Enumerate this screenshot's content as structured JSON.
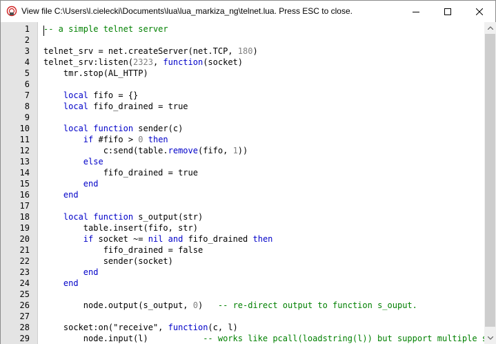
{
  "window": {
    "title": "View file C:\\Users\\l.cielecki\\Documents\\lua\\lua_markiza_ng\\telnet.lua. Press ESC to close.",
    "icons": {
      "app": "telnet-app-icon",
      "minimize": "minimize-icon",
      "maximize": "maximize-icon",
      "close": "close-icon"
    }
  },
  "editor": {
    "language": "lua",
    "lines": [
      {
        "n": "1",
        "segs": [
          [
            "cm",
            "-- a simple telnet server"
          ]
        ]
      },
      {
        "n": "2",
        "segs": []
      },
      {
        "n": "3",
        "segs": [
          [
            "t",
            "telnet_srv = net.createServer(net.TCP, "
          ],
          [
            "nm",
            "180"
          ],
          [
            "t",
            ")"
          ]
        ]
      },
      {
        "n": "4",
        "segs": [
          [
            "t",
            "telnet_srv:listen("
          ],
          [
            "nm",
            "2323"
          ],
          [
            "t",
            ", "
          ],
          [
            "kw",
            "function"
          ],
          [
            "t",
            "(socket)"
          ]
        ]
      },
      {
        "n": "5",
        "segs": [
          [
            "t",
            "    tmr.stop(AL_HTTP)"
          ]
        ]
      },
      {
        "n": "6",
        "segs": []
      },
      {
        "n": "7",
        "segs": [
          [
            "t",
            "    "
          ],
          [
            "kw",
            "local"
          ],
          [
            "t",
            " fifo = {}"
          ]
        ]
      },
      {
        "n": "8",
        "segs": [
          [
            "t",
            "    "
          ],
          [
            "kw",
            "local"
          ],
          [
            "t",
            " fifo_drained = true"
          ]
        ]
      },
      {
        "n": "9",
        "segs": []
      },
      {
        "n": "10",
        "segs": [
          [
            "t",
            "    "
          ],
          [
            "kw",
            "local function"
          ],
          [
            "t",
            " sender(c)"
          ]
        ]
      },
      {
        "n": "11",
        "segs": [
          [
            "t",
            "        "
          ],
          [
            "kw",
            "if"
          ],
          [
            "t",
            " #fifo > "
          ],
          [
            "nm",
            "0"
          ],
          [
            "t",
            " "
          ],
          [
            "kw",
            "then"
          ]
        ]
      },
      {
        "n": "12",
        "segs": [
          [
            "t",
            "            c:send(table."
          ],
          [
            "fn",
            "remove"
          ],
          [
            "t",
            "(fifo, "
          ],
          [
            "nm",
            "1"
          ],
          [
            "t",
            "))"
          ]
        ]
      },
      {
        "n": "13",
        "segs": [
          [
            "t",
            "        "
          ],
          [
            "kw",
            "else"
          ]
        ]
      },
      {
        "n": "14",
        "segs": [
          [
            "t",
            "            fifo_drained = true"
          ]
        ]
      },
      {
        "n": "15",
        "segs": [
          [
            "t",
            "        "
          ],
          [
            "kw",
            "end"
          ]
        ]
      },
      {
        "n": "16",
        "segs": [
          [
            "t",
            "    "
          ],
          [
            "kw",
            "end"
          ]
        ]
      },
      {
        "n": "17",
        "segs": []
      },
      {
        "n": "18",
        "segs": [
          [
            "t",
            "    "
          ],
          [
            "kw",
            "local function"
          ],
          [
            "t",
            " s_output(str)"
          ]
        ]
      },
      {
        "n": "19",
        "segs": [
          [
            "t",
            "        table.insert(fifo, str)"
          ]
        ]
      },
      {
        "n": "20",
        "segs": [
          [
            "t",
            "        "
          ],
          [
            "kw",
            "if"
          ],
          [
            "t",
            " socket ~= "
          ],
          [
            "kw",
            "nil"
          ],
          [
            "t",
            " "
          ],
          [
            "kw",
            "and"
          ],
          [
            "t",
            " fifo_drained "
          ],
          [
            "kw",
            "then"
          ]
        ]
      },
      {
        "n": "21",
        "segs": [
          [
            "t",
            "            fifo_drained = false"
          ]
        ]
      },
      {
        "n": "22",
        "segs": [
          [
            "t",
            "            sender(socket)"
          ]
        ]
      },
      {
        "n": "23",
        "segs": [
          [
            "t",
            "        "
          ],
          [
            "kw",
            "end"
          ]
        ]
      },
      {
        "n": "24",
        "segs": [
          [
            "t",
            "    "
          ],
          [
            "kw",
            "end"
          ]
        ]
      },
      {
        "n": "25",
        "segs": []
      },
      {
        "n": "26",
        "segs": [
          [
            "t",
            "        node.output(s_output, "
          ],
          [
            "nm",
            "0"
          ],
          [
            "t",
            ")   "
          ],
          [
            "cm",
            "-- re-direct output to function s_ouput."
          ]
        ]
      },
      {
        "n": "27",
        "segs": []
      },
      {
        "n": "28",
        "segs": [
          [
            "t",
            "    socket:on(\"receive\", "
          ],
          [
            "kw",
            "function"
          ],
          [
            "t",
            "(c, l)"
          ]
        ]
      },
      {
        "n": "29",
        "segs": [
          [
            "t",
            "        node.input(l)           "
          ],
          [
            "cm",
            "-- works like pcall(loadstring(l)) but support multiple s"
          ]
        ]
      }
    ]
  }
}
